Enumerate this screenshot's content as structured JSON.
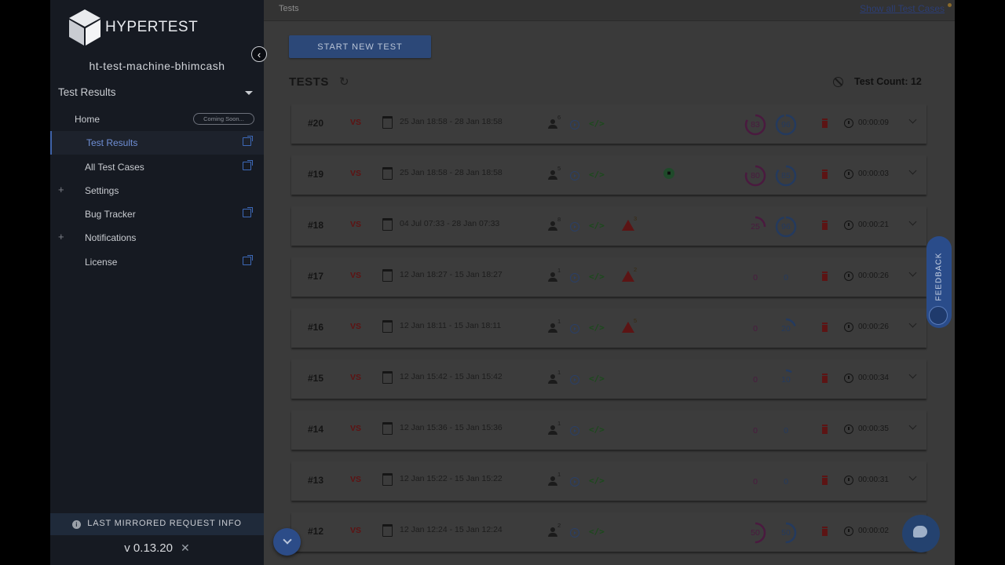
{
  "app": {
    "logo_text": "HYPERTEST",
    "machine_name": "ht-test-machine-bhimcash",
    "version": "v 0.13.20"
  },
  "sidebar": {
    "section_title": "Test Results",
    "items": [
      {
        "label": "Home",
        "badge": "Coming Soon..."
      },
      {
        "label": "Test Results",
        "active": true
      },
      {
        "label": "All Test Cases"
      },
      {
        "label": "Settings",
        "expandable": true
      },
      {
        "label": "Bug Tracker"
      },
      {
        "label": "Notifications",
        "expandable": true
      },
      {
        "label": "License"
      }
    ],
    "mirror_label": "LAST MIRRORED REQUEST INFO"
  },
  "header": {
    "breadcrumb": "Tests",
    "show_all_link": "Show all Test Cases"
  },
  "toolbar": {
    "start_label": "START NEW TEST",
    "title": "TESTS",
    "test_count_label": "Test Count: 12"
  },
  "feedback_label": "FEEDBACK",
  "tests": [
    {
      "id": "#20",
      "vs": "VS",
      "date": "25 Jan 18:58 - 28 Jan 18:58",
      "users": "6",
      "warn": "",
      "lock": false,
      "g1": "83",
      "g2": "96",
      "duration": "00:00:09"
    },
    {
      "id": "#19",
      "vs": "VS",
      "date": "25 Jan 18:58 - 28 Jan 18:58",
      "users": "5",
      "warn": "",
      "lock": true,
      "g1": "80",
      "g2": "85",
      "duration": "00:00:03"
    },
    {
      "id": "#18",
      "vs": "VS",
      "date": "04 Jul 07:33 - 28 Jan 07:33",
      "users": "8",
      "warn": "3",
      "lock": false,
      "g1": "25",
      "g2": "96",
      "duration": "00:00:21"
    },
    {
      "id": "#17",
      "vs": "VS",
      "date": "12 Jan 18:27 - 15 Jan 18:27",
      "users": "1",
      "warn": "2",
      "lock": false,
      "g1": "0",
      "g2": "0",
      "duration": "00:00:26"
    },
    {
      "id": "#16",
      "vs": "VS",
      "date": "12 Jan 18:11 - 15 Jan 18:11",
      "users": "1",
      "warn": "5",
      "lock": false,
      "g1": "0",
      "g2": "20",
      "duration": "00:00:26"
    },
    {
      "id": "#15",
      "vs": "VS",
      "date": "12 Jan 15:42 - 15 Jan 15:42",
      "users": "1",
      "warn": "",
      "lock": false,
      "g1": "0",
      "g2": "10",
      "duration": "00:00:34"
    },
    {
      "id": "#14",
      "vs": "VS",
      "date": "12 Jan 15:36 - 15 Jan 15:36",
      "users": "1",
      "warn": "",
      "lock": false,
      "g1": "0",
      "g2": "0",
      "duration": "00:00:35"
    },
    {
      "id": "#13",
      "vs": "VS",
      "date": "12 Jan 15:22 - 15 Jan 15:22",
      "users": "1",
      "warn": "",
      "lock": false,
      "g1": "0",
      "g2": "0",
      "duration": "00:00:31"
    },
    {
      "id": "#12",
      "vs": "VS",
      "date": "12 Jan 12:24 - 15 Jan 12:24",
      "users": "2",
      "warn": "",
      "lock": false,
      "g1": "50",
      "g2": "50",
      "duration": "00:00:02"
    }
  ],
  "colors": {
    "gauge1": "#4a1a3f",
    "gauge2": "#243a5e",
    "gauge_track": "#333333"
  }
}
